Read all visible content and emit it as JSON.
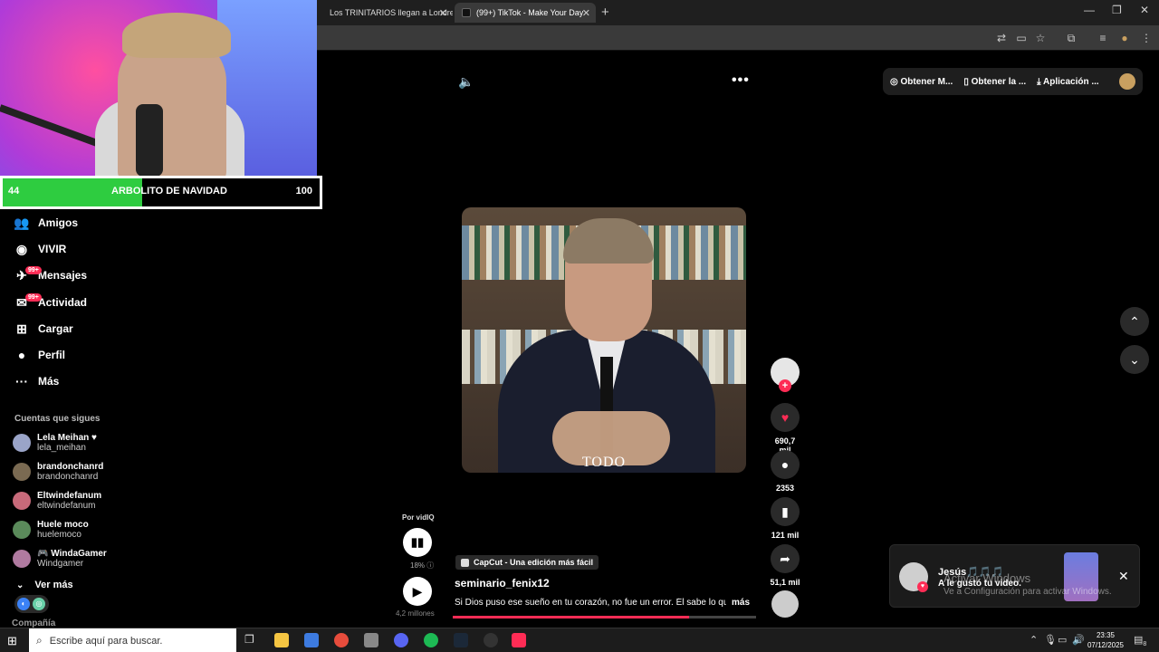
{
  "browser": {
    "tab1": "Los TRINITARIOS llegan a Londres",
    "tab2": "(99+) TikTok - Make Your Day",
    "tab_close": "✕",
    "new_tab": "+",
    "win_min": "—",
    "win_restore": "❐",
    "win_close": "✕"
  },
  "stream_overlay": {
    "counter_left": "44",
    "goal_label": "ARBOLITO DE NAVIDAD",
    "counter_right": "100",
    "progress_fraction": 0.44
  },
  "sidebar": {
    "items": [
      {
        "label": "Amigos",
        "icon": "friends-icon",
        "glyph": "👥"
      },
      {
        "label": "VIVIR",
        "icon": "live-icon",
        "glyph": "◉"
      },
      {
        "label": "Mensajes",
        "icon": "messages-icon",
        "glyph": "✈",
        "badge": "99+"
      },
      {
        "label": "Actividad",
        "icon": "activity-icon",
        "glyph": "✉",
        "badge": "99+"
      },
      {
        "label": "Cargar",
        "icon": "upload-icon",
        "glyph": "⊞"
      },
      {
        "label": "Perfil",
        "icon": "profile-icon",
        "glyph": "●"
      },
      {
        "label": "Más",
        "icon": "more-icon",
        "glyph": "···"
      }
    ],
    "following_title": "Cuentas que sigues",
    "following": [
      {
        "name": "Lela Meihan ♥",
        "handle": "lela_meihan",
        "color": "#9aa4c8"
      },
      {
        "name": "brandonchanrd",
        "handle": "brandonchanrd",
        "color": "#7a6a52"
      },
      {
        "name": "Eltwindefanum",
        "handle": "eltwindefanum",
        "color": "#c86a7a"
      },
      {
        "name": "Huele moco",
        "handle": "huelemoco",
        "color": "#5a8a5a"
      },
      {
        "name": "🎮 WindaGamer",
        "handle": "Windgamer",
        "color": "#b07aa0"
      }
    ],
    "see_more": "Ver más",
    "company": "Compañía"
  },
  "topbar": {
    "btn1": "Obtener M...",
    "btn2": "Obtener la ...",
    "btn3": "Aplicación ..."
  },
  "video": {
    "caption_text": "TODO",
    "by_label": "Por vidIQ",
    "percent": "18%",
    "views": "4,2 millones",
    "capcut_label": "CapCut - Una edición más fácil",
    "username": "seminario_fenix12",
    "description": "Si Dios puso ese sueño en tu corazón, no fue un error. Él sabe lo que",
    "more": "más",
    "progress_fraction": 0.78
  },
  "actions": {
    "likes": "690,7 mil",
    "comments": "2353",
    "saves": "121 mil",
    "shares": "51,1 mil"
  },
  "notification": {
    "name": "Jesús🎵🎵🎵",
    "text": "A le gustó tu video.",
    "close": "✕"
  },
  "watermark": {
    "line1": "Activar Windows",
    "line2": "Ve a Configuración para activar Windows."
  },
  "taskbar": {
    "search_placeholder": "Escribe aquí para buscar.",
    "time": "23:35",
    "date": "07/12/2025",
    "notif_count": "8"
  }
}
